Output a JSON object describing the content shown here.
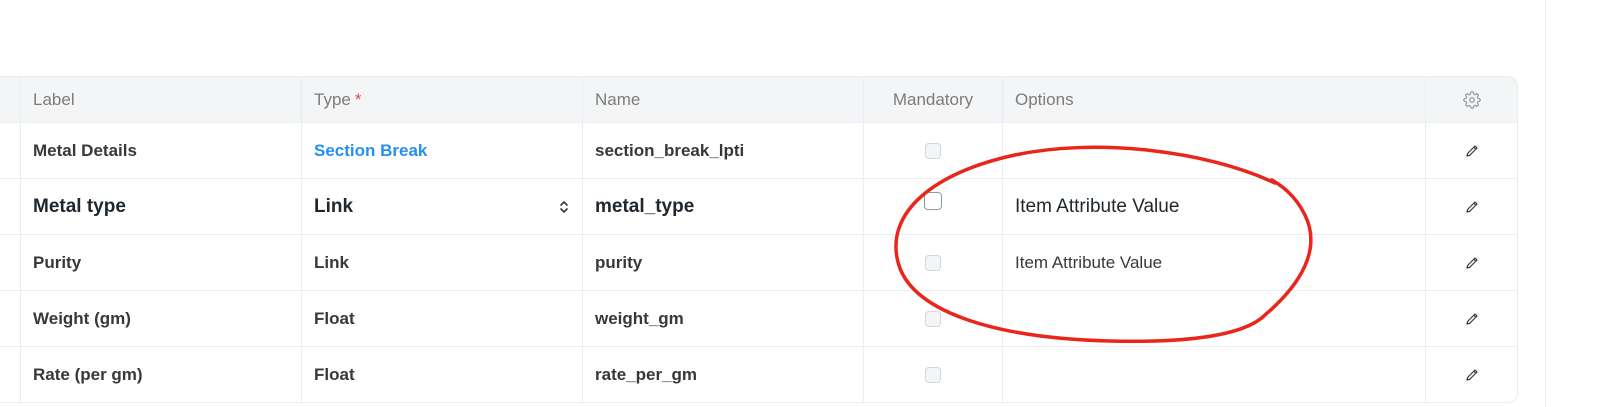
{
  "table": {
    "headers": {
      "label": "Label",
      "type": "Type",
      "type_required_mark": "*",
      "name": "Name",
      "mandatory": "Mandatory",
      "options": "Options",
      "settings_icon": "gear-icon"
    },
    "rows": [
      {
        "label": "Metal Details",
        "type": "Section Break",
        "name": "section_break_lpti",
        "mandatory": false,
        "options": ""
      },
      {
        "label": "Metal type",
        "type": "Link",
        "name": "metal_type",
        "mandatory": false,
        "options": "Item Attribute Value"
      },
      {
        "label": "Purity",
        "type": "Link",
        "name": "purity",
        "mandatory": false,
        "options": "Item Attribute Value"
      },
      {
        "label": "Weight (gm)",
        "type": "Float",
        "name": "weight_gm",
        "mandatory": false,
        "options": ""
      },
      {
        "label": "Rate (per gm)",
        "type": "Float",
        "name": "rate_per_gm",
        "mandatory": false,
        "options": ""
      }
    ]
  },
  "colors": {
    "section_break_link": "#2490ef",
    "annotation_circle": "#e8261c",
    "required_mark": "#e24c4c"
  }
}
